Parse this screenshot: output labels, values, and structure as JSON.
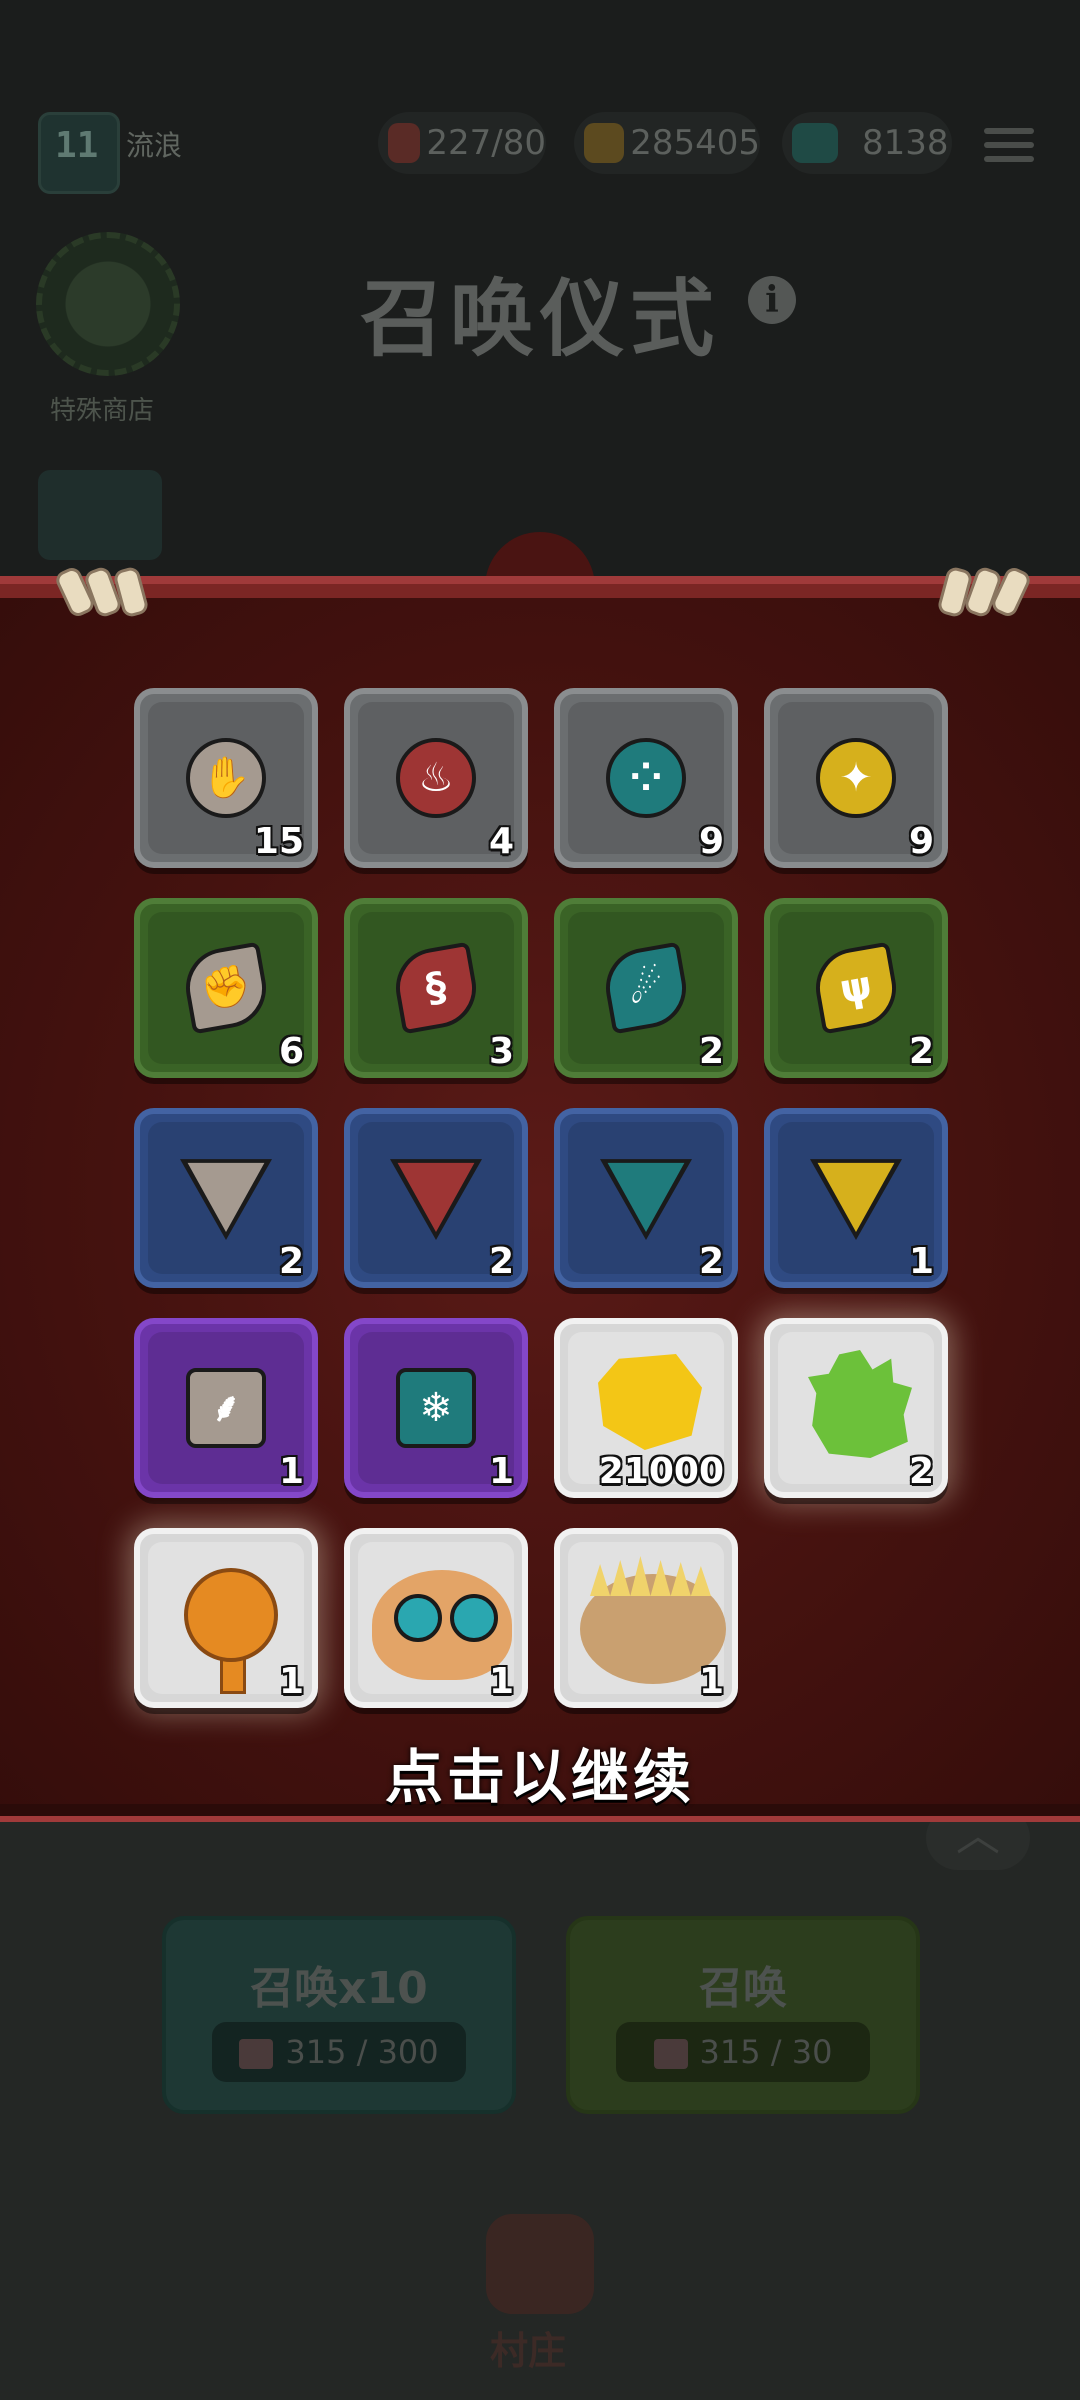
{
  "header": {
    "player_level": "11",
    "player_name": "流浪",
    "resources": [
      {
        "name": "meat",
        "icon": "meat-icon",
        "value": "227/80"
      },
      {
        "name": "gold",
        "icon": "gold-ore-icon",
        "value": "285405"
      },
      {
        "name": "gems",
        "icon": "emerald-icon",
        "value": "8138"
      }
    ]
  },
  "left_menu": {
    "shop_label": "特殊商店"
  },
  "page_title": "召唤仪式",
  "summon": {
    "summon10_label": "召唤x10",
    "summon10_cost": "315 / 300",
    "summon1_label": "召唤",
    "summon1_cost": "315 / 30"
  },
  "bottom_nav": {
    "village_label": "村庄"
  },
  "rewards": {
    "continue_text": "点击以继续",
    "items": [
      {
        "rarity": "gray",
        "icon": "stone-claw-rune-icon",
        "count": "15"
      },
      {
        "rarity": "gray",
        "icon": "fire-bucket-rune-icon",
        "count": "4"
      },
      {
        "rarity": "gray",
        "icon": "water-drops-rune-icon",
        "count": "9"
      },
      {
        "rarity": "gray",
        "icon": "lightning-stars-rune-icon",
        "count": "9"
      },
      {
        "rarity": "green",
        "icon": "stone-fist-rune-icon",
        "count": "6"
      },
      {
        "rarity": "green",
        "icon": "fire-swirl-rune-icon",
        "count": "3"
      },
      {
        "rarity": "green",
        "icon": "water-comet-rune-icon",
        "count": "2"
      },
      {
        "rarity": "green",
        "icon": "lightning-sprout-rune-icon",
        "count": "2"
      },
      {
        "rarity": "blue",
        "icon": "stone-ring-rune-icon",
        "count": "2"
      },
      {
        "rarity": "blue",
        "icon": "fire-pillar-rune-icon",
        "count": "2"
      },
      {
        "rarity": "blue",
        "icon": "ice-crystal-rune-icon",
        "count": "2"
      },
      {
        "rarity": "blue",
        "icon": "lightning-cloud-rune-icon",
        "count": "1"
      },
      {
        "rarity": "purple",
        "icon": "stone-branch-rune-icon",
        "count": "1"
      },
      {
        "rarity": "purple",
        "icon": "snowflake-rune-icon",
        "count": "1"
      },
      {
        "rarity": "white",
        "icon": "gold-nugget-icon",
        "count": "21000"
      },
      {
        "rarity": "white",
        "icon": "green-crystal-icon",
        "count": "2"
      },
      {
        "rarity": "white",
        "icon": "golden-key-icon",
        "count": "1"
      },
      {
        "rarity": "white",
        "icon": "cat-portrait-icon",
        "count": "1"
      },
      {
        "rarity": "white",
        "icon": "hedgehog-portrait-icon",
        "count": "1"
      }
    ]
  },
  "colors": {
    "panel_bg": "#4a1411",
    "panel_rim": "#a03a3a",
    "tile_gray": "#6b6e70",
    "tile_green": "#3a6326",
    "tile_blue": "#2f4a82",
    "tile_purple": "#6b34a8",
    "tile_white": "#d7d7d7"
  }
}
